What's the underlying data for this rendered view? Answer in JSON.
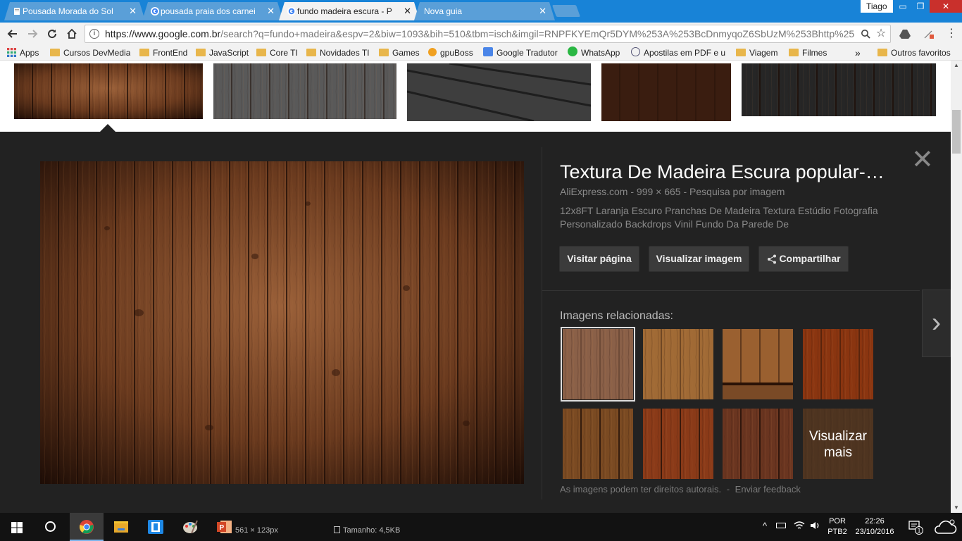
{
  "tabs": [
    {
      "title": "Pousada Morada do Sol",
      "icon": "page-icon",
      "active": false
    },
    {
      "title": "pousada praia dos carnei",
      "icon": "google-icon",
      "active": false
    },
    {
      "title": "fundo madeira escura - P",
      "icon": "google-icon",
      "active": true
    },
    {
      "title": "Nova guia",
      "icon": "none",
      "active": false
    }
  ],
  "tab_close": "✕",
  "user": "Tiago",
  "window_controls": {
    "minimize": "▭",
    "restore": "❐",
    "close": "✕"
  },
  "url": {
    "host": "https://www.google.com.br",
    "path": "/search?q=fundo+madeira&espv=2&biw=1093&bih=510&tbm=isch&imgil=RNPFKYEmQr5DYM%253A%253BcDnmyqoZ6SbUzM%253Bhttp%25"
  },
  "bookmarks": {
    "items": [
      {
        "label": "Apps",
        "type": "apps"
      },
      {
        "label": "Cursos DevMedia",
        "type": "folder"
      },
      {
        "label": "FrontEnd",
        "type": "folder"
      },
      {
        "label": "JavaScript",
        "type": "folder"
      },
      {
        "label": "Core TI",
        "type": "folder"
      },
      {
        "label": "Novidades TI",
        "type": "folder"
      },
      {
        "label": "Games",
        "type": "folder"
      },
      {
        "label": "gpuBoss",
        "type": "site"
      },
      {
        "label": "Google Tradutor",
        "type": "site"
      },
      {
        "label": "WhatsApp",
        "type": "site"
      },
      {
        "label": "Apostilas em PDF e u",
        "type": "site"
      },
      {
        "label": "Viagem",
        "type": "folder"
      },
      {
        "label": "Filmes",
        "type": "folder"
      }
    ],
    "overflow": "»",
    "other": "Outros favoritos"
  },
  "detail": {
    "title": "Textura De Madeira Escura popular-…",
    "source": "AliExpress.com",
    "dimensions": "999 × 665",
    "search_by_image": "Pesquisa por imagem",
    "sep": "-",
    "description": "12x8FT Laranja Escuro Pranchas De Madeira Textura Estúdio Fotografia Personalizado Backdrops Vinil Fundo Da Parede De",
    "buttons": {
      "visit": "Visitar página",
      "view": "Visualizar imagem",
      "share": "Compartilhar"
    },
    "related_heading": "Imagens relacionadas:",
    "more": "Visualizar mais",
    "disclaimer": "As imagens podem ter direitos autorais.",
    "feedback": "Enviar feedback",
    "close": "✕",
    "next": "›"
  },
  "status": {
    "size_px": "561 × 123px",
    "size_kb": "Tamanho: 4,5KB"
  },
  "taskbar": {
    "apps": [
      "chrome-icon",
      "file-explorer-icon",
      "app-icon",
      "paint-icon",
      "powerpoint-icon"
    ],
    "lang_top": "POR",
    "lang_bottom": "PTB2",
    "time": "22:26",
    "date": "23/10/2016",
    "notif_count": "1"
  }
}
